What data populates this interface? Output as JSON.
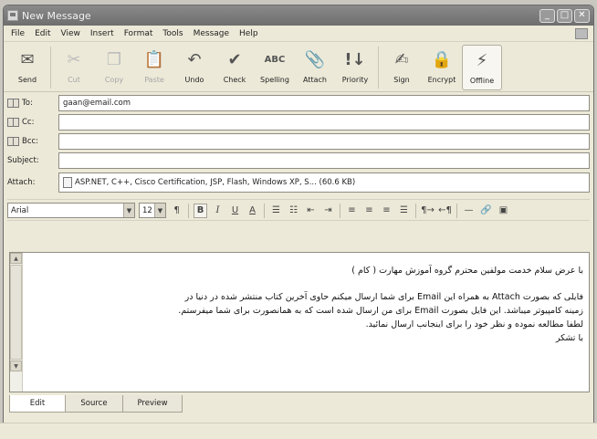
{
  "window": {
    "title": "New Message"
  },
  "menu": [
    "File",
    "Edit",
    "View",
    "Insert",
    "Format",
    "Tools",
    "Message",
    "Help"
  ],
  "toolbar": [
    {
      "label": "Send",
      "icon": "send-icon",
      "enabled": true
    },
    {
      "label": "Cut",
      "icon": "scissors-icon",
      "enabled": false
    },
    {
      "label": "Copy",
      "icon": "copy-icon",
      "enabled": false
    },
    {
      "label": "Paste",
      "icon": "paste-icon",
      "enabled": false
    },
    {
      "label": "Undo",
      "icon": "undo-icon",
      "enabled": true
    },
    {
      "label": "Check",
      "icon": "check-names-icon",
      "enabled": true
    },
    {
      "label": "Spelling",
      "icon": "spelling-icon",
      "enabled": true
    },
    {
      "label": "Attach",
      "icon": "paperclip-icon",
      "enabled": true
    },
    {
      "label": "Priority",
      "icon": "priority-icon",
      "enabled": true
    },
    {
      "label": "Sign",
      "icon": "sign-icon",
      "enabled": true
    },
    {
      "label": "Encrypt",
      "icon": "encrypt-icon",
      "enabled": true
    },
    {
      "label": "Offline",
      "icon": "offline-icon",
      "enabled": true
    }
  ],
  "fields": {
    "to_label": "To:",
    "to_value": "gaan@email.com",
    "cc_label": "Cc:",
    "cc_value": "",
    "bcc_label": "Bcc:",
    "bcc_value": "",
    "subject_label": "Subject:",
    "subject_value": "",
    "attach_label": "Attach:",
    "attach_value": "ASP.NET, C++, Cisco Certification, JSP, Flash, Windows XP, S... (60.6 KB)"
  },
  "format": {
    "font": "Arial",
    "size": "12"
  },
  "body": {
    "greeting": "با عرض سلام خدمت مولفین محترم گروه آموزش مهارت ( کام )",
    "line1": "فایلی که بصورت Attach به همراه این Email برای شما ارسال میکنم حاوی آخرین کتاب منتشر شده در دنیا در",
    "line2": "زمینه کامپیوتر میباشد. این فایل بصورت Email برای من ارسال شده است که به همانصورت برای شما میفرستم.",
    "line3": "لطفا مطالعه نموده و نظر خود را برای اینجانب ارسال نمائید.",
    "closing": "با تشکر"
  },
  "tabs": [
    "Edit",
    "Source",
    "Preview"
  ]
}
